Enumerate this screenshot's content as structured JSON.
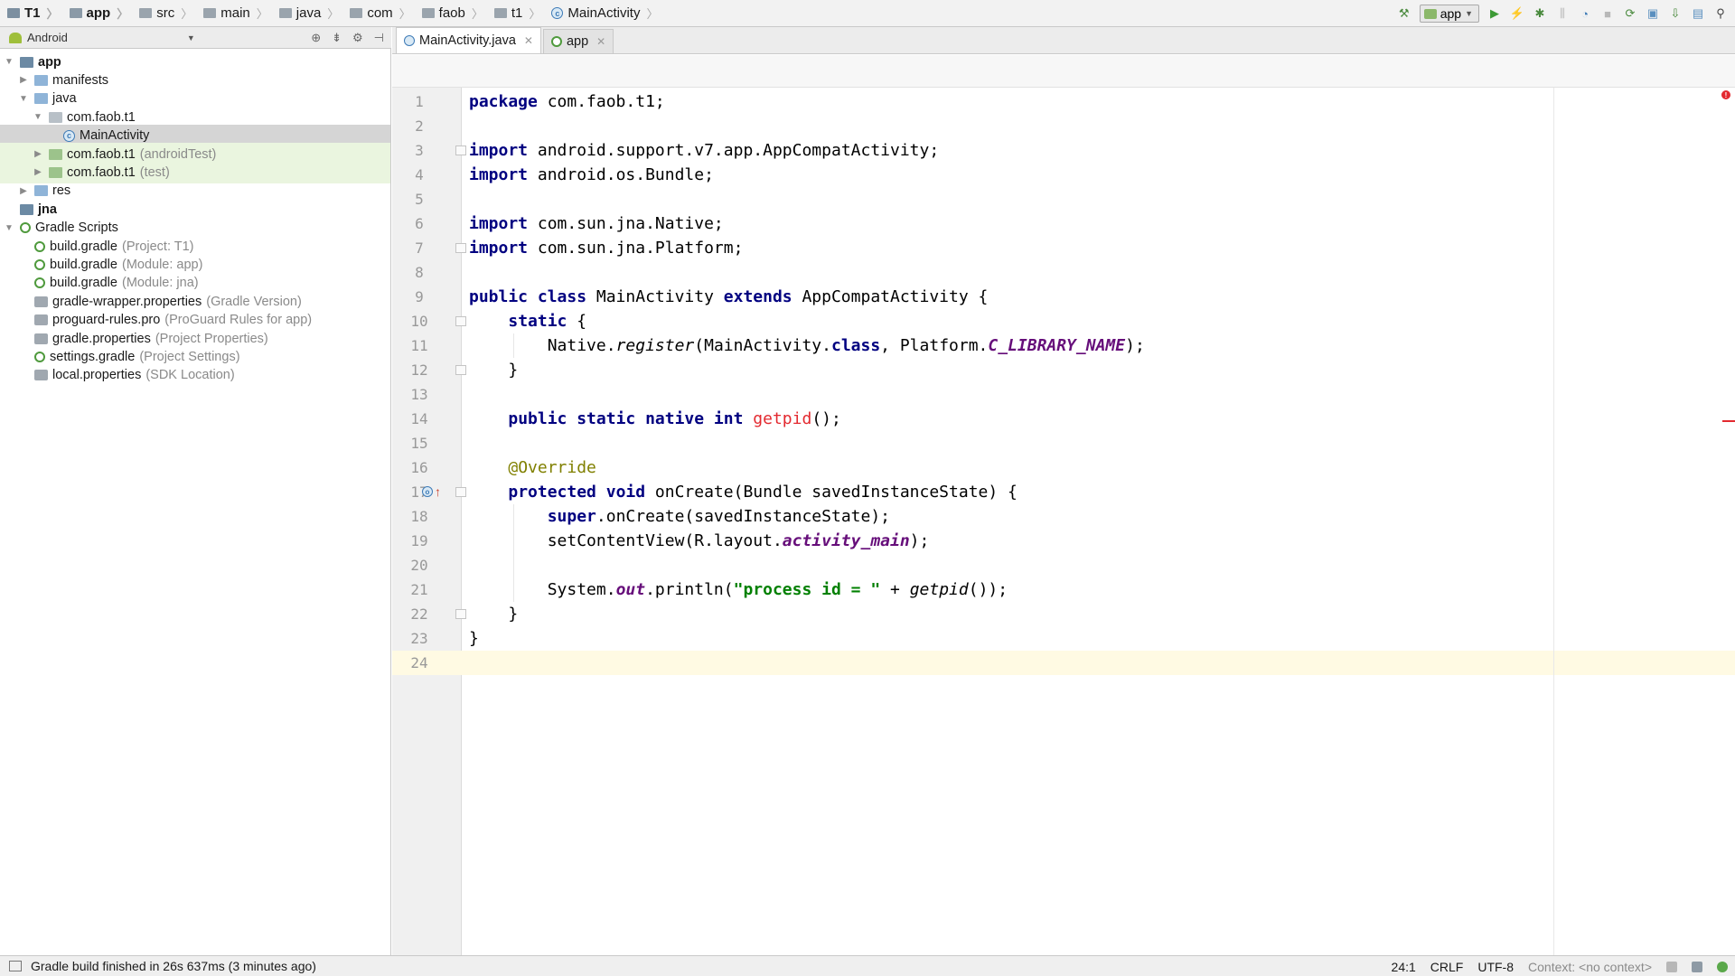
{
  "breadcrumb": [
    {
      "label": "T1",
      "icon": "project-icon",
      "bold": true
    },
    {
      "label": "app",
      "icon": "module-icon",
      "bold": true
    },
    {
      "label": "src",
      "icon": "folder-icon",
      "bold": false
    },
    {
      "label": "main",
      "icon": "folder-icon",
      "bold": false
    },
    {
      "label": "java",
      "icon": "folder-icon",
      "bold": false
    },
    {
      "label": "com",
      "icon": "folder-icon",
      "bold": false
    },
    {
      "label": "faob",
      "icon": "folder-icon",
      "bold": false
    },
    {
      "label": "t1",
      "icon": "folder-icon",
      "bold": false
    },
    {
      "label": "MainActivity",
      "icon": "class-icon",
      "bold": false
    }
  ],
  "toolbar": {
    "run_config_label": "app",
    "icons": [
      "make-project-icon",
      "run-icon",
      "apply-changes-icon",
      "debug-icon",
      "attach-debugger-icon",
      "profile-icon",
      "stop-icon",
      "sync-gradle-icon",
      "avd-manager-icon",
      "sdk-manager-icon",
      "project-structure-icon",
      "search-icon"
    ]
  },
  "project_panel": {
    "view_mode": "Android",
    "tree": [
      {
        "label": "app",
        "hint": "",
        "icon": "module-icon",
        "toggle": "expanded",
        "indent": 0,
        "bold": true,
        "state": ""
      },
      {
        "label": "manifests",
        "hint": "",
        "icon": "folder-icon",
        "toggle": "collapsed",
        "indent": 1,
        "bold": false,
        "state": ""
      },
      {
        "label": "java",
        "hint": "",
        "icon": "folder-icon",
        "toggle": "expanded",
        "indent": 1,
        "bold": false,
        "state": ""
      },
      {
        "label": "com.faob.t1",
        "hint": "",
        "icon": "package-icon",
        "toggle": "expanded",
        "indent": 2,
        "bold": false,
        "state": ""
      },
      {
        "label": "MainActivity",
        "hint": "",
        "icon": "class-icon",
        "toggle": "none",
        "indent": 3,
        "bold": false,
        "state": "selected"
      },
      {
        "label": "com.faob.t1",
        "hint": "(androidTest)",
        "icon": "package-icon",
        "toggle": "collapsed",
        "indent": 2,
        "bold": false,
        "state": "test"
      },
      {
        "label": "com.faob.t1",
        "hint": "(test)",
        "icon": "package-icon",
        "toggle": "collapsed",
        "indent": 2,
        "bold": false,
        "state": "test"
      },
      {
        "label": "res",
        "hint": "",
        "icon": "folder-icon",
        "toggle": "collapsed",
        "indent": 1,
        "bold": false,
        "state": ""
      },
      {
        "label": "jna",
        "hint": "",
        "icon": "module-icon",
        "toggle": "none",
        "indent": 0,
        "bold": true,
        "state": ""
      },
      {
        "label": "Gradle Scripts",
        "hint": "",
        "icon": "gradle-icon",
        "toggle": "expanded",
        "indent": 0,
        "bold": false,
        "state": ""
      },
      {
        "label": "build.gradle",
        "hint": "(Project: T1)",
        "icon": "gradle-icon",
        "toggle": "none",
        "indent": 1,
        "bold": false,
        "state": ""
      },
      {
        "label": "build.gradle",
        "hint": "(Module: app)",
        "icon": "gradle-icon",
        "toggle": "none",
        "indent": 1,
        "bold": false,
        "state": ""
      },
      {
        "label": "build.gradle",
        "hint": "(Module: jna)",
        "icon": "gradle-icon",
        "toggle": "none",
        "indent": 1,
        "bold": false,
        "state": ""
      },
      {
        "label": "gradle-wrapper.properties",
        "hint": "(Gradle Version)",
        "icon": "properties-icon",
        "toggle": "none",
        "indent": 1,
        "bold": false,
        "state": ""
      },
      {
        "label": "proguard-rules.pro",
        "hint": "(ProGuard Rules for app)",
        "icon": "properties-icon",
        "toggle": "none",
        "indent": 1,
        "bold": false,
        "state": ""
      },
      {
        "label": "gradle.properties",
        "hint": "(Project Properties)",
        "icon": "properties-icon",
        "toggle": "none",
        "indent": 1,
        "bold": false,
        "state": ""
      },
      {
        "label": "settings.gradle",
        "hint": "(Project Settings)",
        "icon": "gradle-icon",
        "toggle": "none",
        "indent": 1,
        "bold": false,
        "state": ""
      },
      {
        "label": "local.properties",
        "hint": "(SDK Location)",
        "icon": "properties-icon",
        "toggle": "none",
        "indent": 1,
        "bold": false,
        "state": ""
      }
    ]
  },
  "editor": {
    "tabs": [
      {
        "label": "MainActivity.java",
        "icon": "class-icon",
        "active": true
      },
      {
        "label": "app",
        "icon": "gradle-icon",
        "active": false
      }
    ],
    "caret_line": 24,
    "lines": [
      [
        {
          "t": "package",
          "c": "kw"
        },
        {
          "t": " com.faob.t1;",
          "c": ""
        }
      ],
      [],
      [
        {
          "t": "import",
          "c": "kw"
        },
        {
          "t": " android.support.v7.app.AppCompatActivity;",
          "c": ""
        }
      ],
      [
        {
          "t": "import",
          "c": "kw"
        },
        {
          "t": " android.os.Bundle;",
          "c": ""
        }
      ],
      [],
      [
        {
          "t": "import",
          "c": "kw"
        },
        {
          "t": " com.sun.jna.Native;",
          "c": ""
        }
      ],
      [
        {
          "t": "import",
          "c": "kw"
        },
        {
          "t": " com.sun.jna.Platform;",
          "c": ""
        }
      ],
      [],
      [
        {
          "t": "public class",
          "c": "kw"
        },
        {
          "t": " MainActivity ",
          "c": ""
        },
        {
          "t": "extends",
          "c": "kw"
        },
        {
          "t": " AppCompatActivity {",
          "c": ""
        }
      ],
      [
        {
          "t": "    ",
          "c": ""
        },
        {
          "t": "static",
          "c": "kw"
        },
        {
          "t": " {",
          "c": ""
        }
      ],
      [
        {
          "t": "        Native.",
          "c": ""
        },
        {
          "t": "register",
          "c": "it"
        },
        {
          "t": "(MainActivity.",
          "c": ""
        },
        {
          "t": "class",
          "c": "kw"
        },
        {
          "t": ", Platform.",
          "c": ""
        },
        {
          "t": "C_LIBRARY_NAME",
          "c": "stat-it"
        },
        {
          "t": ");",
          "c": ""
        }
      ],
      [
        {
          "t": "    }",
          "c": ""
        }
      ],
      [],
      [
        {
          "t": "    ",
          "c": ""
        },
        {
          "t": "public static native int",
          "c": "kw"
        },
        {
          "t": " ",
          "c": ""
        },
        {
          "t": "getpid",
          "c": "err"
        },
        {
          "t": "();",
          "c": ""
        }
      ],
      [],
      [
        {
          "t": "    ",
          "c": ""
        },
        {
          "t": "@Override",
          "c": "ann"
        }
      ],
      [
        {
          "t": "    ",
          "c": ""
        },
        {
          "t": "protected void",
          "c": "kw"
        },
        {
          "t": " onCreate(Bundle savedInstanceState) {",
          "c": ""
        }
      ],
      [
        {
          "t": "        ",
          "c": ""
        },
        {
          "t": "super",
          "c": "kw"
        },
        {
          "t": ".onCreate(savedInstanceState);",
          "c": ""
        }
      ],
      [
        {
          "t": "        setContentView(R.layout.",
          "c": ""
        },
        {
          "t": "activity_main",
          "c": "stat-it"
        },
        {
          "t": ");",
          "c": ""
        }
      ],
      [],
      [
        {
          "t": "        System.",
          "c": ""
        },
        {
          "t": "out",
          "c": "stat-it"
        },
        {
          "t": ".println(",
          "c": ""
        },
        {
          "t": "\"process id = \"",
          "c": "str"
        },
        {
          "t": " + ",
          "c": ""
        },
        {
          "t": "getpid",
          "c": "ref-it"
        },
        {
          "t": "());",
          "c": ""
        }
      ],
      [
        {
          "t": "    }",
          "c": ""
        }
      ],
      [
        {
          "t": "}",
          "c": ""
        }
      ],
      []
    ]
  },
  "status": {
    "message": "Gradle build finished in 26s 637ms (3 minutes ago)",
    "position": "24:1",
    "line_separator": "CRLF",
    "encoding": "UTF-8",
    "context": "Context: <no context>"
  }
}
